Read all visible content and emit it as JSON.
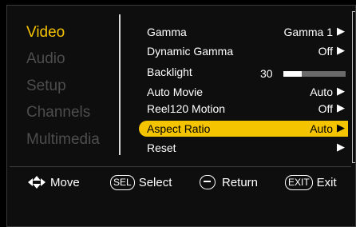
{
  "sidebar": {
    "categories": [
      {
        "label": "Video",
        "active": true
      },
      {
        "label": "Audio",
        "active": false
      },
      {
        "label": "Setup",
        "active": false
      },
      {
        "label": "Channels",
        "active": false
      },
      {
        "label": "Multimedia",
        "active": false
      }
    ]
  },
  "menu": {
    "items": [
      {
        "label": "Gamma",
        "value": "Gamma 1",
        "arrow": "▶"
      },
      {
        "label": "Dynamic Gamma",
        "value": "Off",
        "arrow": "▶"
      },
      {
        "label": "Backlight",
        "value": "30",
        "level": 0.3
      },
      {
        "label": "Auto Movie",
        "value": "Auto",
        "arrow": "▶"
      },
      {
        "label": "Reel120 Motion",
        "value": "Off",
        "arrow": "▶"
      },
      {
        "label": "Aspect Ratio",
        "value": "Auto",
        "arrow": "▶",
        "selected": true
      },
      {
        "label": "Reset",
        "value": "",
        "arrow": "▶"
      }
    ]
  },
  "footer": {
    "move_label": "Move",
    "sel_key": "SEL",
    "select_label": "Select",
    "return_label": "Return",
    "exit_key": "EXIT",
    "exit_label": "Exit"
  },
  "colors": {
    "accent": "#f5c400",
    "inactive_text": "#4d4d4d",
    "background": "#000000"
  },
  "icons": {
    "move": "dpad-arrows-icon",
    "return": "return-key-icon"
  }
}
